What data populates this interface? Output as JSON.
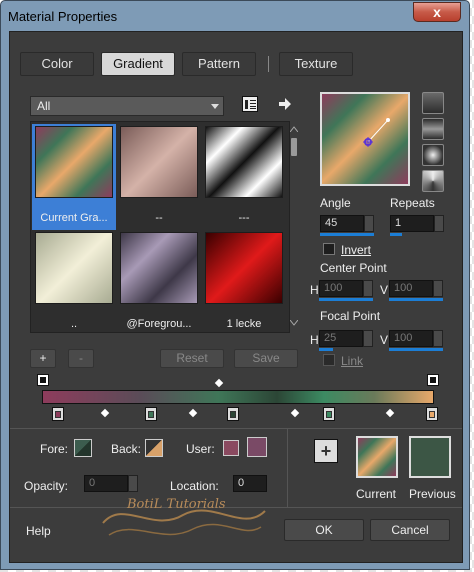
{
  "window": {
    "title": "Material Properties",
    "close": "x"
  },
  "tabs": [
    {
      "label": "Color"
    },
    {
      "label": "Gradient"
    },
    {
      "label": "Pattern"
    },
    {
      "label": "Texture"
    }
  ],
  "category_dropdown": {
    "value": "All"
  },
  "gradients": [
    {
      "label": "Current Gra...",
      "colors": [
        "#8e3c5c",
        "#3f7658",
        "#e8a86a",
        "#3f7658",
        "#8e3c5c"
      ]
    },
    {
      "label": "--",
      "colors": [
        "#7a5c58",
        "#d4b2a8",
        "#7a5c58"
      ]
    },
    {
      "label": "---",
      "colors": [
        "#111111",
        "#ffffff",
        "#111111",
        "#ffffff",
        "#111111"
      ]
    },
    {
      "label": "..",
      "colors": [
        "#a8ab92",
        "#f2efd8",
        "#a8ab92"
      ]
    },
    {
      "label": "@Foregrou...",
      "colors": [
        "#3e3848",
        "#a89ab6",
        "#3e3848",
        "#a89ab6"
      ]
    },
    {
      "label": "1 lecke",
      "colors": [
        "#3a0000",
        "#e01a1a",
        "#3a0000"
      ]
    }
  ],
  "gradient_buttons": {
    "add": "+",
    "remove": "-",
    "reset": "Reset",
    "save": "Save"
  },
  "angle": {
    "label": "Angle",
    "value": "45"
  },
  "repeats": {
    "label": "Repeats",
    "value": "1"
  },
  "invert_label": "Invert",
  "center_point": {
    "label": "Center Point",
    "h_label": "H",
    "h": "100",
    "v_label": "V",
    "v": "100"
  },
  "focal_point": {
    "label": "Focal Point",
    "h_label": "H",
    "h": "25",
    "v_label": "V",
    "v": "100"
  },
  "link_label": "Link",
  "stops": [
    {
      "color": "#8e3c5c"
    },
    {
      "color": "#3f7658"
    },
    {
      "color": "#2c4636"
    },
    {
      "color": "#3c8a62"
    },
    {
      "color": "#e8a86a"
    }
  ],
  "fore_label": "Fore:",
  "back_label": "Back:",
  "user_label": "User:",
  "opacity": {
    "label": "Opacity:",
    "value": "0"
  },
  "location": {
    "label": "Location:",
    "value": "0"
  },
  "add_material": "+",
  "current_label": "Current",
  "previous_label": "Previous",
  "watermark": "BotiL Tutorials",
  "buttons": {
    "help": "Help",
    "ok": "OK",
    "cancel": "Cancel"
  },
  "colors": {
    "accent": "#1c7ed6",
    "user_swatch_1": "#8a4a60",
    "user_swatch_2": "#7a4a66",
    "previous_fill": "#3c5645"
  }
}
